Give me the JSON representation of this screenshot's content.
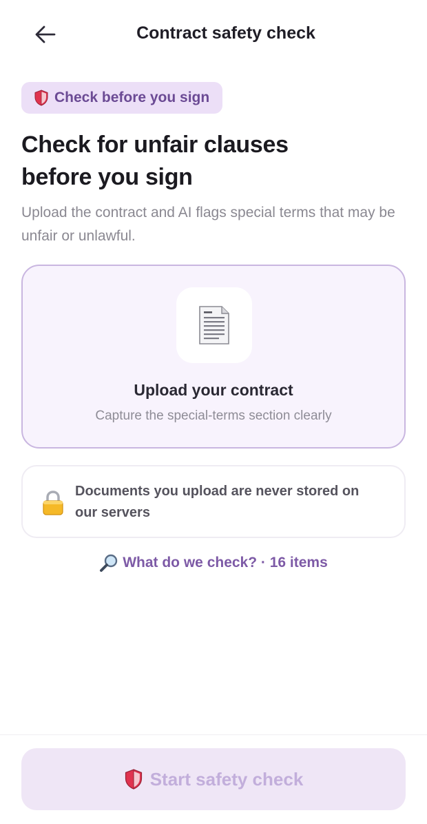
{
  "header": {
    "title": "Contract safety check",
    "back_icon": "arrow-left-icon"
  },
  "badge": {
    "icon": "shield-icon",
    "label": "Check before you sign"
  },
  "hero": {
    "heading_line1": "Check for unfair clauses",
    "heading_line2": "before you sign",
    "subtitle": "Upload the contract and AI flags special terms that may be unfair or unlawful."
  },
  "upload": {
    "icon": "document-icon",
    "title": "Upload your contract",
    "subtitle": "Capture the special-terms section clearly"
  },
  "privacy": {
    "icon": "lock-icon",
    "text": "Documents you upload are never stored on our servers"
  },
  "check_link": {
    "icon": "magnifier-icon",
    "label": "What do we check? · 16 items"
  },
  "start_button": {
    "icon": "shield-icon",
    "label": "Start safety check",
    "state": "disabled"
  },
  "colors": {
    "accent": "#7d5aa6",
    "badge_bg": "#ecdff7",
    "upload_border": "#c9b6e0",
    "button_disabled_bg": "#efe6f6",
    "shield_red": "#e0334f"
  }
}
